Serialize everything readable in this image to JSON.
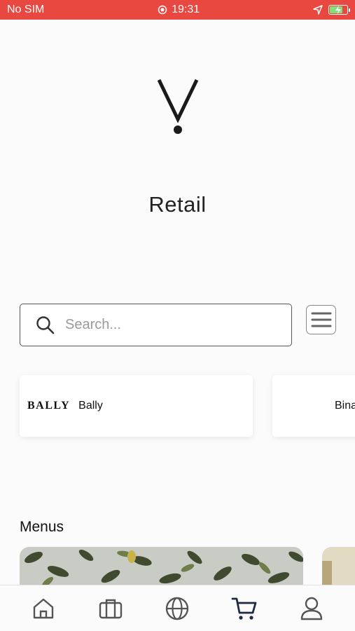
{
  "status_bar": {
    "carrier": "No SIM",
    "time": "19:31"
  },
  "header": {
    "title": "Retail"
  },
  "search": {
    "placeholder": "Search..."
  },
  "brands": [
    {
      "logo_text": "BALLY",
      "name": "Bally"
    },
    {
      "name": "Bina"
    }
  ],
  "sections": {
    "menus_title": "Menus"
  },
  "bottom_nav": {
    "items": [
      {
        "icon": "home-icon"
      },
      {
        "icon": "briefcase-icon"
      },
      {
        "icon": "globe-icon"
      },
      {
        "icon": "cart-icon",
        "active": true
      },
      {
        "icon": "user-icon"
      }
    ]
  },
  "colors": {
    "status_bar": "#e8483f",
    "text": "#222222",
    "nav_active": "#1f2a44",
    "nav_inactive": "#555555"
  }
}
